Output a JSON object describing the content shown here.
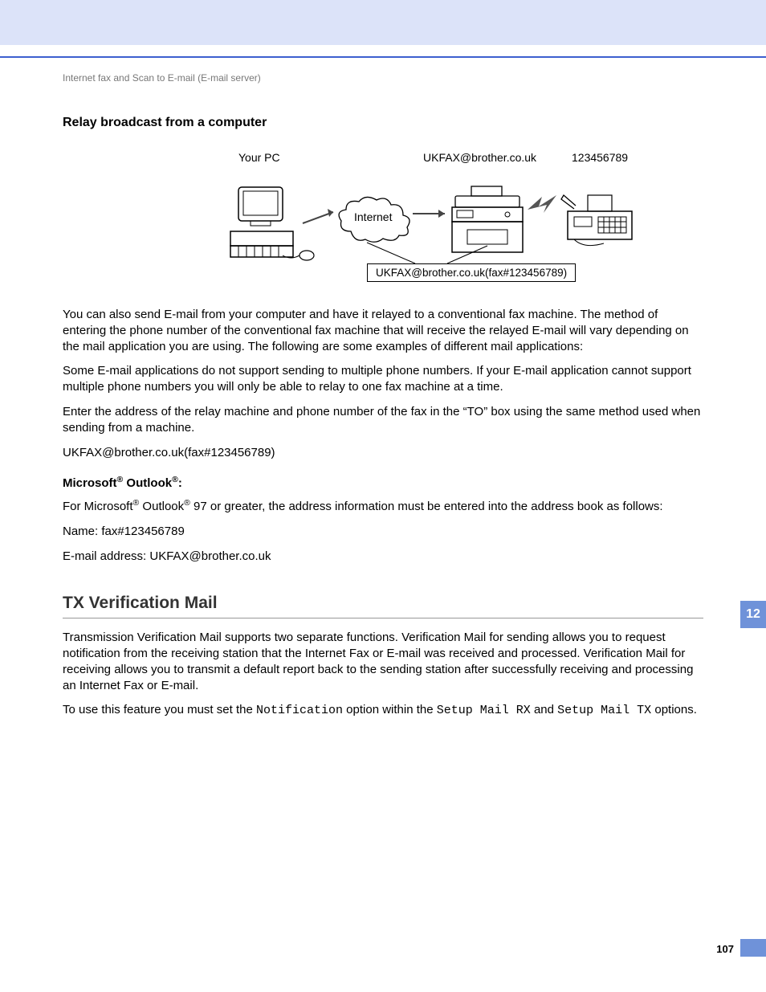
{
  "header": "Internet fax and Scan to E-mail (E-mail server)",
  "h1": "Relay broadcast from a computer",
  "diagram": {
    "pc": "Your PC",
    "email": "UKFAX@brother.co.uk",
    "fax_num": "123456789",
    "internet": "Internet",
    "combined": "UKFAX@brother.co.uk(fax#123456789)"
  },
  "p1": "You can also send E-mail from your computer and have it relayed to a conventional fax machine. The method of entering the phone number of the conventional fax machine that will receive the relayed E-mail will vary depending on the mail application you are using. The following are some examples of different mail applications:",
  "p2": "Some E-mail applications do not support sending to multiple phone numbers. If your E-mail application cannot support multiple phone numbers you will only be able to relay to one fax machine at a time.",
  "p3": "Enter the address of the relay machine and phone number of the fax in the “TO” box using the same method used when sending from a machine.",
  "p4": "UKFAX@brother.co.uk(fax#123456789)",
  "outlook": {
    "heading_pre": "Microsoft",
    "heading_mid": " Outlook",
    "heading_post": ":",
    "body_pre": "For Microsoft",
    "body_mid": " Outlook",
    "body_post": " 97 or greater, the address information must be entered into the address book as follows:",
    "name": "Name: fax#123456789",
    "email": "E-mail address: UKFAX@brother.co.uk"
  },
  "tx": {
    "heading": "TX Verification Mail",
    "p1": "Transmission Verification Mail supports two separate functions. Verification Mail for sending allows you to request notification from the receiving station that the Internet Fax or E-mail was received and processed. Verification Mail for receiving allows you to transmit a default report back to the sending station after successfully receiving and processing an Internet Fax or E-mail.",
    "p2_pre": "To use this feature you must set the ",
    "p2_m1": "Notification",
    "p2_mid": " option within the ",
    "p2_m2": "Setup Mail RX",
    "p2_mid2": " and ",
    "p2_m3": "Setup Mail TX",
    "p2_post": " options."
  },
  "chapter": "12",
  "page_num": "107"
}
